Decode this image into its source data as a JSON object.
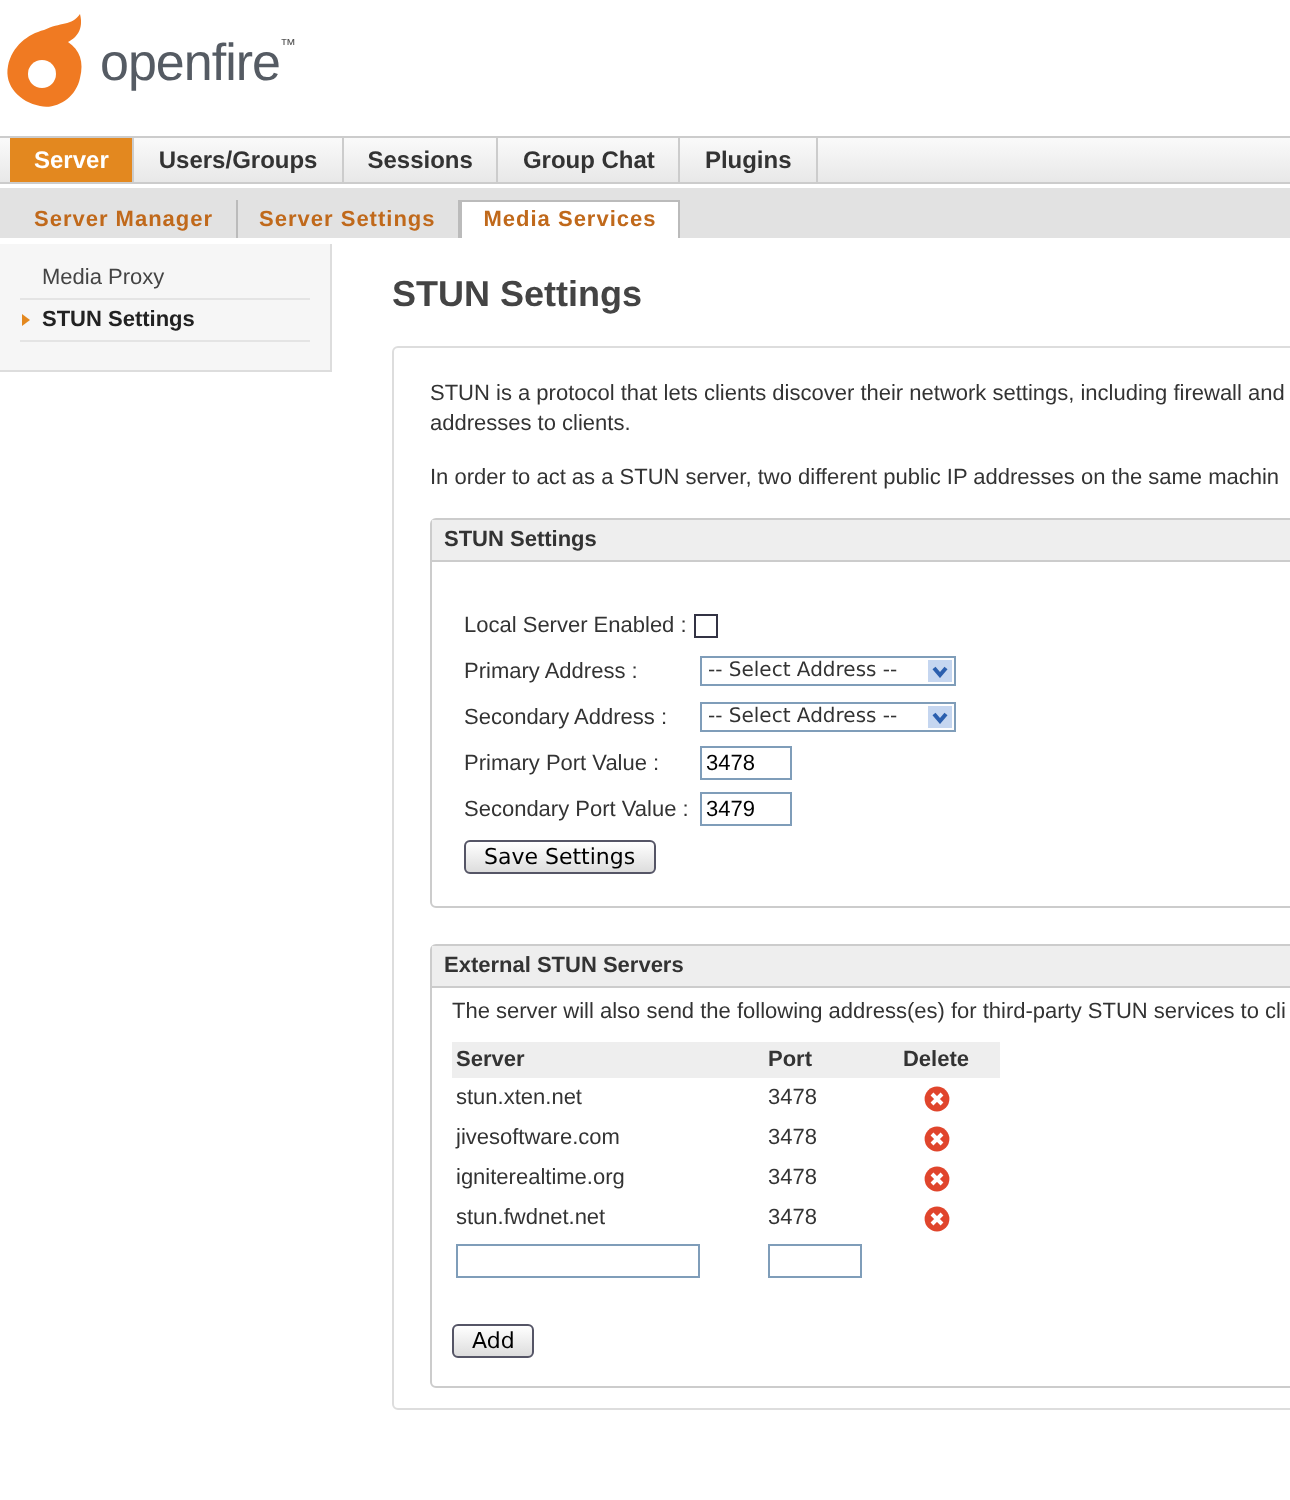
{
  "logo": {
    "text": "openfire",
    "trademark": "™"
  },
  "main_tabs": [
    {
      "label": "Server",
      "selected": true
    },
    {
      "label": "Users/Groups",
      "selected": false
    },
    {
      "label": "Sessions",
      "selected": false
    },
    {
      "label": "Group Chat",
      "selected": false
    },
    {
      "label": "Plugins",
      "selected": false
    }
  ],
  "sub_tabs": [
    {
      "label": "Server Manager",
      "selected": false
    },
    {
      "label": "Server Settings",
      "selected": false
    },
    {
      "label": "Media Services",
      "selected": true
    }
  ],
  "sidebar": {
    "items": [
      {
        "label": "Media Proxy",
        "selected": false
      },
      {
        "label": "STUN Settings",
        "selected": true
      }
    ]
  },
  "page_title": "STUN Settings",
  "intro_lines": [
    "STUN is a protocol that lets clients discover their network settings, including firewall and",
    "addresses to clients."
  ],
  "intro_note": "In order to act as a STUN server, two different public IP addresses on the same machin",
  "stun_settings": {
    "title": "STUN Settings",
    "fields": [
      {
        "kind": "checkbox",
        "label": "Local Server Enabled :",
        "checked": false
      },
      {
        "kind": "select",
        "label": "Primary Address :",
        "value": "-- Select Address --"
      },
      {
        "kind": "select",
        "label": "Secondary Address :",
        "value": "-- Select Address --"
      },
      {
        "kind": "text",
        "label": "Primary Port Value :",
        "value": "3478"
      },
      {
        "kind": "text",
        "label": "Secondary Port Value :",
        "value": "3479"
      }
    ],
    "button": "Save Settings"
  },
  "external_servers": {
    "title": "External STUN Servers",
    "description": "The server will also send the following address(es) for third-party STUN services to cli",
    "columns": [
      "Server",
      "Port",
      "Delete"
    ],
    "rows": [
      {
        "server": "stun.xten.net",
        "port": "3478"
      },
      {
        "server": "jivesoftware.com",
        "port": "3478"
      },
      {
        "server": "igniterealtime.org",
        "port": "3478"
      },
      {
        "server": "stun.fwdnet.net",
        "port": "3478"
      }
    ],
    "button": "Add"
  }
}
